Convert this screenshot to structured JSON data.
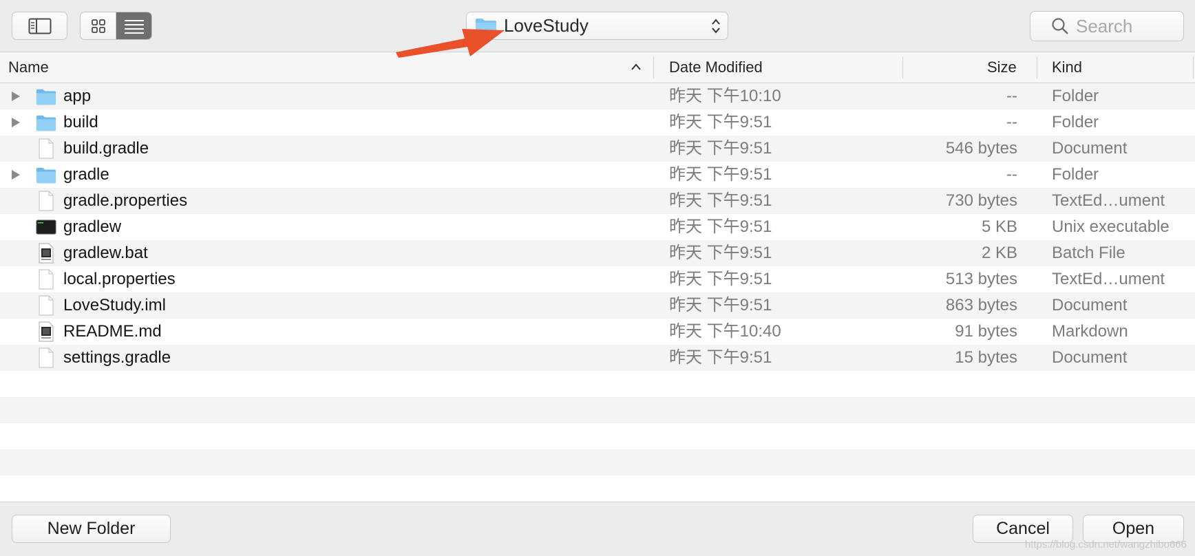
{
  "toolbar": {
    "path_label": "LoveStudy",
    "search_placeholder": "Search"
  },
  "columns": {
    "name": "Name",
    "date": "Date Modified",
    "size": "Size",
    "kind": "Kind"
  },
  "files": [
    {
      "name": "app",
      "date": "昨天 下午10:10",
      "size": "--",
      "kind": "Folder",
      "icon": "folder-icon",
      "expandable": true
    },
    {
      "name": "build",
      "date": "昨天 下午9:51",
      "size": "--",
      "kind": "Folder",
      "icon": "folder-icon",
      "expandable": true
    },
    {
      "name": "build.gradle",
      "date": "昨天 下午9:51",
      "size": "546 bytes",
      "kind": "Document",
      "icon": "document-icon",
      "expandable": false
    },
    {
      "name": "gradle",
      "date": "昨天 下午9:51",
      "size": "--",
      "kind": "Folder",
      "icon": "folder-icon",
      "expandable": true
    },
    {
      "name": "gradle.properties",
      "date": "昨天 下午9:51",
      "size": "730 bytes",
      "kind": "TextEd…ument",
      "icon": "document-icon",
      "expandable": false
    },
    {
      "name": "gradlew",
      "date": "昨天 下午9:51",
      "size": "5 KB",
      "kind": "Unix executable",
      "icon": "terminal-icon",
      "expandable": false
    },
    {
      "name": "gradlew.bat",
      "date": "昨天 下午9:51",
      "size": "2 KB",
      "kind": "Batch File",
      "icon": "batch-file-icon",
      "expandable": false
    },
    {
      "name": "local.properties",
      "date": "昨天 下午9:51",
      "size": "513 bytes",
      "kind": "TextEd…ument",
      "icon": "document-icon",
      "expandable": false
    },
    {
      "name": "LoveStudy.iml",
      "date": "昨天 下午9:51",
      "size": "863 bytes",
      "kind": "Document",
      "icon": "document-icon",
      "expandable": false
    },
    {
      "name": "README.md",
      "date": "昨天 下午10:40",
      "size": "91 bytes",
      "kind": "Markdown",
      "icon": "markdown-file-icon",
      "expandable": false
    },
    {
      "name": "settings.gradle",
      "date": "昨天 下午9:51",
      "size": "15 bytes",
      "kind": "Document",
      "icon": "document-icon",
      "expandable": false
    }
  ],
  "empty_rows": 5,
  "footer": {
    "new_folder": "New Folder",
    "cancel": "Cancel",
    "open": "Open"
  },
  "watermark": "https://blog.csdn.net/wangzhibo666",
  "colors": {
    "folder": "#7cc4f1",
    "annotation_arrow": "#e9512a",
    "selected_segment": "#6f6f6f"
  }
}
